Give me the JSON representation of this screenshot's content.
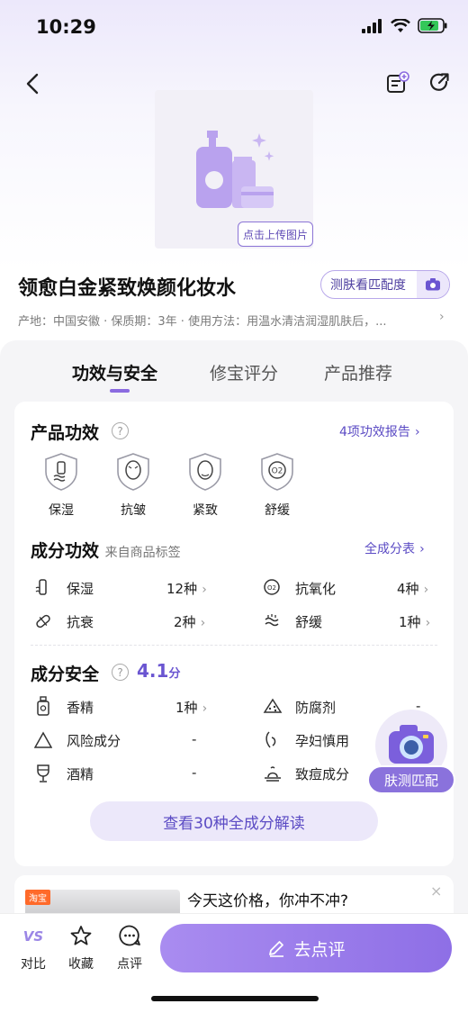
{
  "status": {
    "time": "10:29"
  },
  "product": {
    "upload_label": "点击上传图片",
    "title": "领愈白金紧致焕颜化妆水",
    "skin_match_label": "测肤看匹配度",
    "meta": "产地：中国安徽 · 保质期：3年 · 使用方法：用温水清洁润湿肌肤后，..."
  },
  "tabs": [
    {
      "label": "功效与安全",
      "active": true
    },
    {
      "label": "修宝评分",
      "active": false
    },
    {
      "label": "产品推荐",
      "active": false
    }
  ],
  "efficacy": {
    "title": "产品功效",
    "report_link": "4项功效报告",
    "items": [
      {
        "label": "保湿",
        "icon": "moisturize-icon"
      },
      {
        "label": "抗皱",
        "icon": "anti-wrinkle-icon"
      },
      {
        "label": "紧致",
        "icon": "firming-icon"
      },
      {
        "label": "舒缓",
        "icon": "soothing-icon"
      }
    ]
  },
  "ingredient_efficacy": {
    "title": "成分功效",
    "note": "来自商品标签",
    "link": "全成分表",
    "rows": [
      {
        "label": "保湿",
        "value": "12种",
        "icon": "bottle-icon"
      },
      {
        "label": "抗氧化",
        "value": "4种",
        "icon": "o2-icon"
      },
      {
        "label": "抗衰",
        "value": "2种",
        "icon": "capsule-icon"
      },
      {
        "label": "舒缓",
        "value": "1种",
        "icon": "wave-icon"
      }
    ]
  },
  "ingredient_safety": {
    "title": "成分安全",
    "score": "4.1",
    "score_unit": "分",
    "rows": [
      {
        "label": "香精",
        "value": "1种",
        "icon": "perfume-icon",
        "chevron": true
      },
      {
        "label": "防腐剂",
        "value": "-",
        "icon": "preservative-icon",
        "chevron": false
      },
      {
        "label": "风险成分",
        "value": "-",
        "icon": "warning-icon",
        "chevron": false
      },
      {
        "label": "孕妇慎用",
        "value": "",
        "icon": "pregnancy-icon",
        "chevron": false
      },
      {
        "label": "酒精",
        "value": "-",
        "icon": "wine-icon",
        "chevron": false
      },
      {
        "label": "致痘成分",
        "value": "",
        "icon": "acne-icon",
        "chevron": false
      }
    ]
  },
  "read_all_label": "查看30种全成分解读",
  "floating": {
    "label": "肤测匹配"
  },
  "ad": {
    "tag": "淘宝",
    "text": "今天这价格，你冲不冲?",
    "close": "×"
  },
  "bottom": {
    "compare": "对比",
    "favorite": "收藏",
    "comment": "点评",
    "review_button": "去点评"
  },
  "colors": {
    "accent": "#8b6be0",
    "link": "#5b4bc4",
    "panel_bg": "#f5f5f7"
  }
}
